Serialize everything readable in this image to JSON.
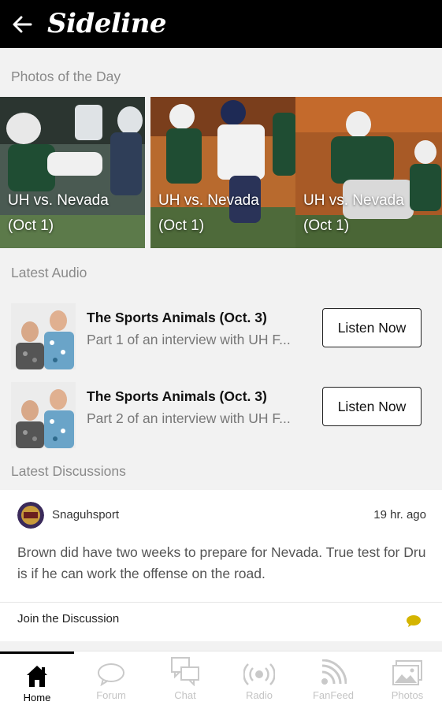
{
  "app": {
    "title": "Sideline"
  },
  "photos": {
    "section_title": "Photos of the Day",
    "items": [
      {
        "caption_line1": "UH vs. Nevada",
        "caption_line2": "(Oct 1)"
      },
      {
        "caption_line1": "UH vs. Nevada",
        "caption_line2": "(Oct 1)"
      },
      {
        "caption_line1": "UH vs. Nevada",
        "caption_line2": "(Oct 1)"
      }
    ]
  },
  "audio": {
    "section_title": "Latest Audio",
    "items": [
      {
        "title": "The Sports Animals (Oct. 3)",
        "subtitle": "Part 1 of an interview with UH F...",
        "button": "Listen Now"
      },
      {
        "title": "The Sports Animals (Oct. 3)",
        "subtitle": "Part 2 of an interview with UH F...",
        "button": "Listen Now"
      }
    ]
  },
  "discussions": {
    "section_title": "Latest Discussions",
    "post": {
      "username": "Snaguhsport",
      "timestamp": "19 hr. ago",
      "body": "Brown did have two weeks to prepare for Nevada. True test for Dru is if he can work the offense on the road.",
      "join_label": "Join the Discussion"
    }
  },
  "nav": {
    "items": [
      {
        "label": "Home",
        "icon": "home-icon",
        "active": true
      },
      {
        "label": "Forum",
        "icon": "forum-icon",
        "active": false
      },
      {
        "label": "Chat",
        "icon": "chat-icon",
        "active": false
      },
      {
        "label": "Radio",
        "icon": "radio-icon",
        "active": false
      },
      {
        "label": "FanFeed",
        "icon": "fanfeed-icon",
        "active": false
      },
      {
        "label": "Photos",
        "icon": "photos-icon",
        "active": false
      }
    ]
  },
  "colors": {
    "appbar": "#000000",
    "background": "#f2f2f2",
    "jersey_green": "#1f4d33",
    "accent_yellow": "#d4b400"
  }
}
